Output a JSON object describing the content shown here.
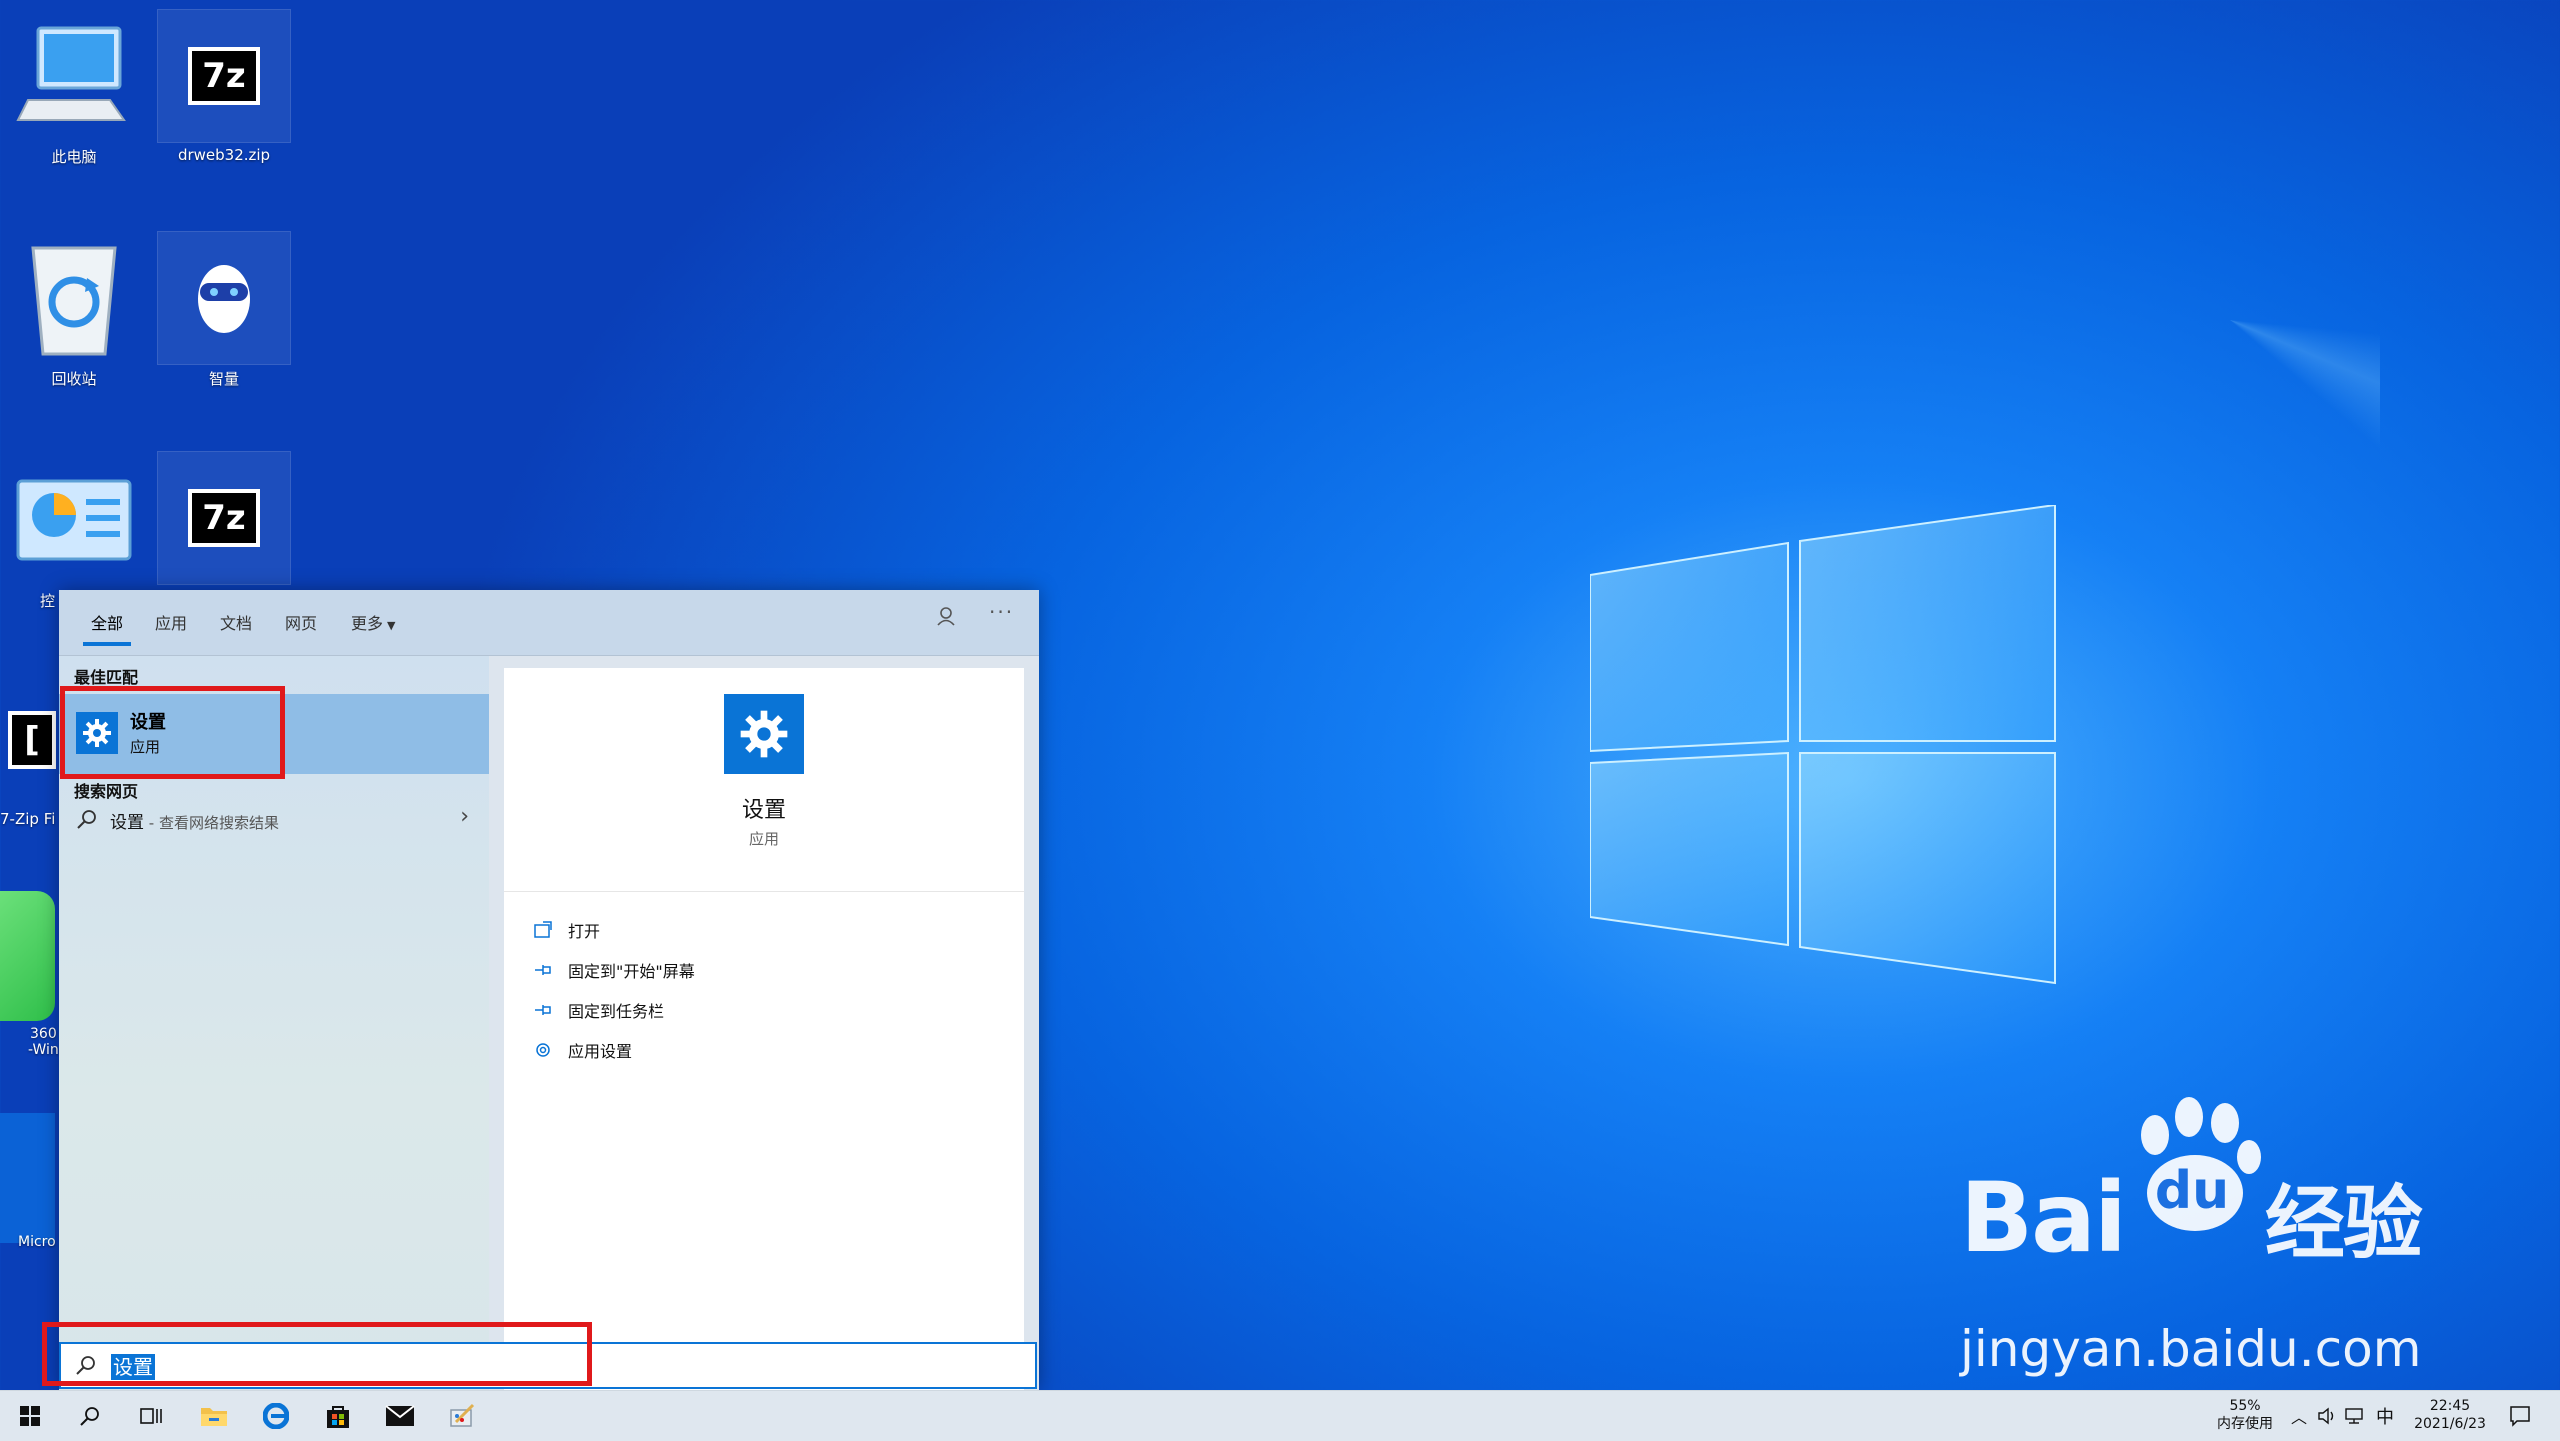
{
  "desktop": {
    "icons": [
      {
        "label": "此电脑"
      },
      {
        "label": "drweb32.zip"
      },
      {
        "label": "回收站"
      },
      {
        "label": "智量"
      },
      {
        "label": "控"
      },
      {
        "label": "7-Zip Fi"
      },
      {
        "label": "360"
      },
      {
        "label": "-Win"
      },
      {
        "label": "Micro"
      }
    ]
  },
  "search_panel": {
    "tabs": [
      "全部",
      "应用",
      "文档",
      "网页",
      "更多"
    ],
    "best_match_header": "最佳匹配",
    "best_match": {
      "name": "设置",
      "kind": "应用"
    },
    "web_header": "搜索网页",
    "web_result": {
      "text": "设置",
      "suffix": " - 查看网络搜索结果"
    },
    "preview": {
      "title": "设置",
      "subtitle": "应用"
    },
    "actions": [
      "打开",
      "固定到\"开始\"屏幕",
      "固定到任务栏",
      "应用设置"
    ]
  },
  "search_box": {
    "value": "设置"
  },
  "taskbar": {
    "memory": {
      "percent": "55%",
      "label": "内存使用"
    },
    "ime": "中",
    "time": "22:45",
    "date": "2021/6/23"
  },
  "watermark": {
    "brand_prefix": "Bai",
    "brand_suffix": "经验",
    "url": "jingyan.baidu.com",
    "du": "du"
  },
  "colors": {
    "accent": "#0a74d6",
    "highlight": "#e0191b"
  }
}
